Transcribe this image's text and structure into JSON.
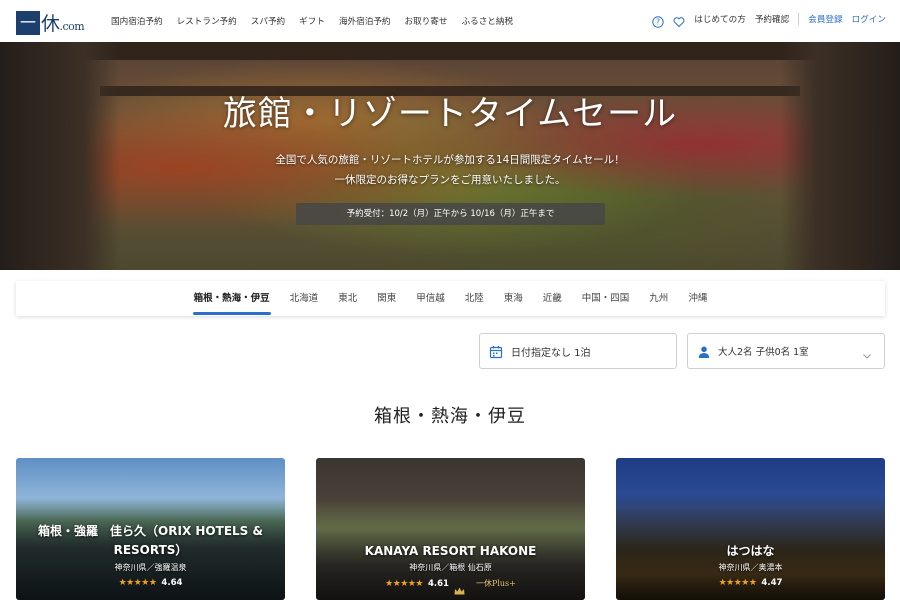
{
  "header": {
    "logo_glyph": "一",
    "logo_text": "休",
    "logo_domain": ".com",
    "nav": [
      "国内宿泊予約",
      "レストラン予約",
      "スパ予約",
      "ギフト",
      "海外宿泊予約",
      "お取り寄せ",
      "ふるさと納税"
    ],
    "right": {
      "help_icon": "question-circle-icon",
      "favorite_icon": "heart-icon",
      "first_time": "はじめての方",
      "reservation_check": "予約確認",
      "register": "会員登録",
      "login": "ログイン"
    }
  },
  "hero": {
    "title": "旅館・リゾートタイムセール",
    "subtitle_line1": "全国で人気の旅館・リゾートホテルが参加する14日間限定タイムセール！",
    "subtitle_line2": "一休限定のお得なプランをご用意いたしました。",
    "period": "予約受付：10/2（月）正午から 10/16（月）正午まで"
  },
  "regions": {
    "active_index": 0,
    "items": [
      "箱根・熱海・伊豆",
      "北海道",
      "東北",
      "関東",
      "甲信越",
      "北陸",
      "東海",
      "近畿",
      "中国・四国",
      "九州",
      "沖縄"
    ]
  },
  "search": {
    "date_text": "日付指定なし 1泊",
    "date_icon": "calendar-icon",
    "guests_text": "大人2名  子供0名  1室",
    "guests_icon": "person-icon"
  },
  "section": {
    "title": "箱根・熱海・伊豆"
  },
  "colors": {
    "accent_blue": "#2a6fc9",
    "logo_navy": "#1d3f6e",
    "star_orange": "#f0a020"
  },
  "hotels": [
    {
      "name": "箱根・強羅　佳ら久（ORIX HOTELS & RESORTS）",
      "location": "神奈川県／強羅温泉",
      "stars": "★★★★★",
      "rating": "4.64",
      "badge": ""
    },
    {
      "name": "KANAYA RESORT HAKONE",
      "location": "神奈川県／箱根 仙石原",
      "stars": "★★★★★",
      "rating": "4.61",
      "badge": "一休Plus+"
    },
    {
      "name": "はつはな",
      "location": "神奈川県／奥湯本",
      "stars": "★★★★★",
      "rating": "4.47",
      "badge": ""
    }
  ]
}
